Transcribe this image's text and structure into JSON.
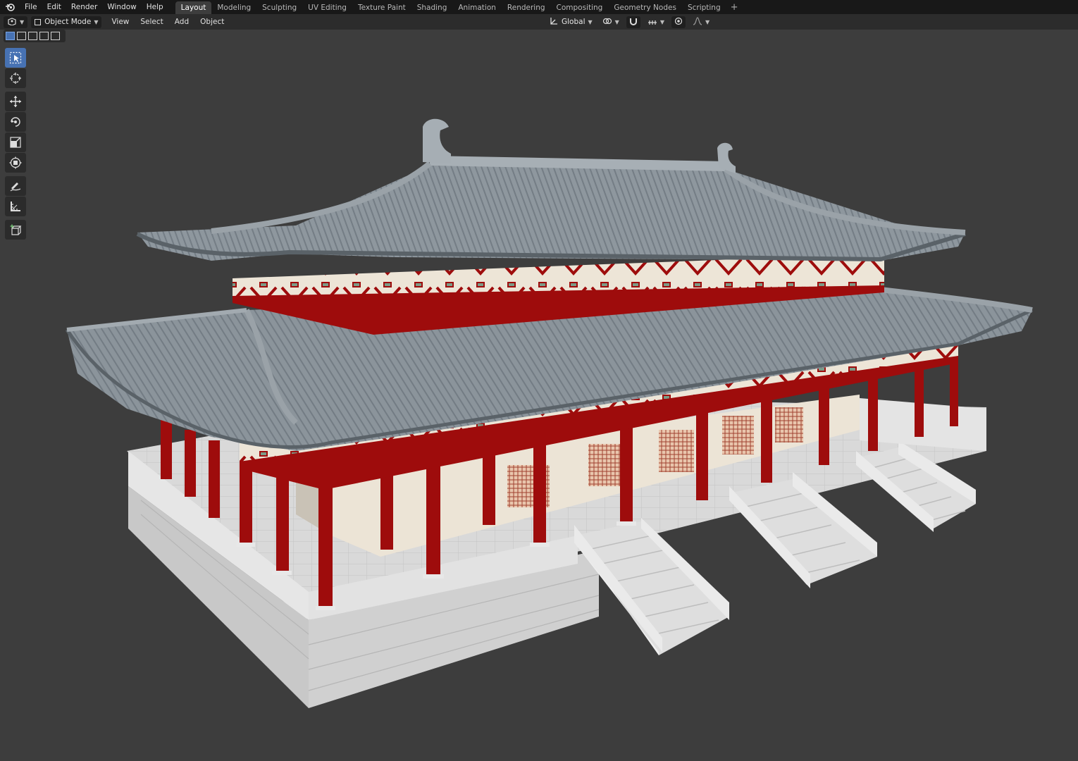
{
  "app": {
    "menus": [
      "File",
      "Edit",
      "Render",
      "Window",
      "Help"
    ],
    "workspaces": [
      "Layout",
      "Modeling",
      "Sculpting",
      "UV Editing",
      "Texture Paint",
      "Shading",
      "Animation",
      "Rendering",
      "Compositing",
      "Geometry Nodes",
      "Scripting"
    ],
    "active_workspace": "Layout",
    "add_workspace": "+"
  },
  "viewport_header": {
    "mode": "Object Mode",
    "menus": [
      "View",
      "Select",
      "Add",
      "Object"
    ],
    "orientation": "Global"
  },
  "toolbar": {
    "tools": [
      "select-box",
      "cursor",
      "move",
      "rotate",
      "scale",
      "transform",
      "annotate",
      "measure",
      "add-cube"
    ],
    "active": "select-box"
  },
  "colors": {
    "viewport_bg": "#3d3d3d",
    "topbar_bg": "#181818",
    "header_bg": "#2c2c2c",
    "accent": "#4772b3",
    "roof": "#8c959c",
    "timber": "#9e0c0c",
    "wall": "#ece4d6",
    "stone": "#dcdcdc"
  }
}
